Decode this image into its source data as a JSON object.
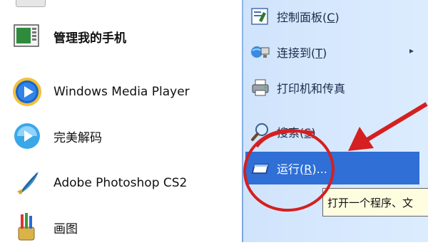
{
  "left_items": [
    {
      "label": "管理我的手机",
      "icon": "phone-manager-icon",
      "bold": true
    },
    {
      "label": "Windows Media Player",
      "icon": "media-player-icon",
      "bold": false
    },
    {
      "label": "完美解码",
      "icon": "perfect-decoder-icon",
      "bold": false
    },
    {
      "label": "Adobe Photoshop CS2",
      "icon": "photoshop-feather-icon",
      "bold": false
    },
    {
      "label": "画图",
      "icon": "paint-brushes-icon",
      "bold": false
    }
  ],
  "right_items": [
    {
      "label_pre": "控制面板(",
      "label_key": "C",
      "label_post": ")",
      "icon": "control-panel-icon"
    },
    {
      "label_pre": "连接到(",
      "label_key": "T",
      "label_post": ")",
      "icon": "network-connect-icon",
      "submenu_arrow": "▸"
    },
    {
      "label_pre": "打印机和传真",
      "label_key": "",
      "label_post": "",
      "icon": "printer-icon"
    },
    {
      "label_pre": "搜索(",
      "label_key": "S",
      "label_post": ")",
      "icon": "search-magnifier-icon"
    },
    {
      "label_pre": "运行(",
      "label_key": "R",
      "label_post": ")...",
      "icon": "run-icon",
      "selected": true
    }
  ],
  "tooltip": {
    "text": "打开一个程序、文"
  },
  "colors": {
    "accent": "#2f6fd6",
    "annotation": "#d42020",
    "right_panel": "#d6e8fd"
  }
}
